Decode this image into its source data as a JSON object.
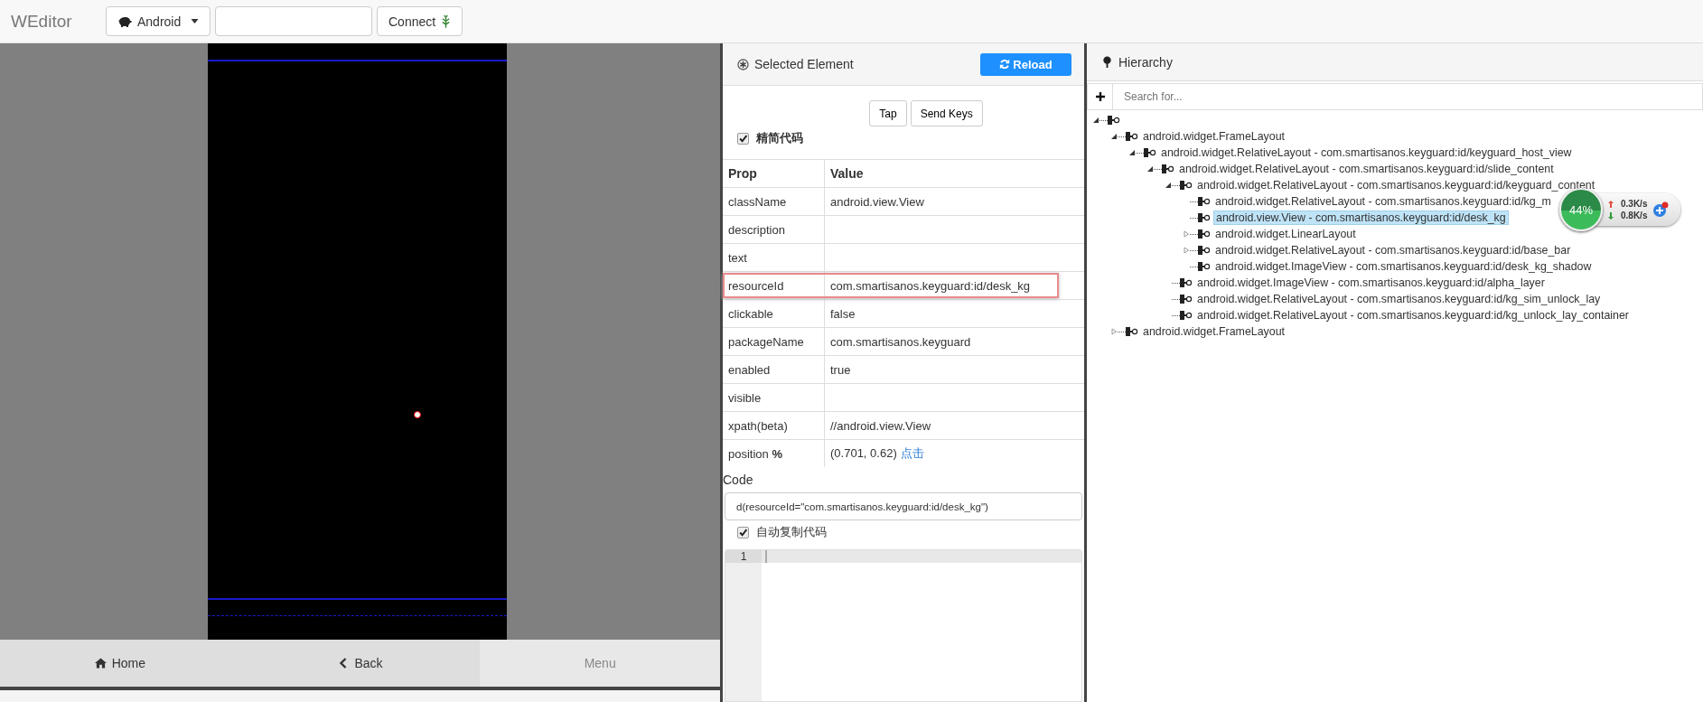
{
  "app_title": "WEditor",
  "toolbar": {
    "platform": "Android",
    "connect": "Connect"
  },
  "device_screen": {
    "tap_marker": true
  },
  "nav_buttons": [
    {
      "label": "Home",
      "kind": "home",
      "disabled": false
    },
    {
      "label": "Back",
      "kind": "back",
      "disabled": false
    },
    {
      "label": "Menu",
      "kind": "menu",
      "disabled": true
    }
  ],
  "selected_element": {
    "title": "Selected Element",
    "reload": "Reload",
    "actions": [
      "Tap",
      "Send Keys"
    ],
    "simplify_code": {
      "label": "精简代码",
      "checked": true
    },
    "columns": [
      "Prop",
      "Value"
    ],
    "rows": [
      {
        "prop": "className",
        "value": "android.view.View",
        "highlighted": false
      },
      {
        "prop": "description",
        "highlighted": false
      },
      {
        "prop": "text",
        "highlighted": false
      },
      {
        "prop": "resourceId",
        "value": "com.smartisanos.keyguard:id/desk_kg",
        "highlighted": true
      },
      {
        "prop": "clickable",
        "value": "false",
        "highlighted": false
      },
      {
        "prop": "packageName",
        "value": "com.smartisanos.keyguard",
        "highlighted": false
      },
      {
        "prop": "enabled",
        "value": "true",
        "highlighted": false
      },
      {
        "prop": "visible",
        "highlighted": false
      },
      {
        "prop": "xpath(beta)",
        "value": "//android.view.View",
        "highlighted": false
      },
      {
        "prop": "position **%**",
        "value": "(0.701, 0.62)",
        "link": "点击",
        "highlighted": false
      }
    ],
    "code_label": "Code",
    "code": "d(resourceId=\"com.smartisanos.keyguard:id/desk_kg\")",
    "auto_copy": {
      "label": "自动复制代码",
      "checked": true
    },
    "editor_lines": [
      "1"
    ]
  },
  "hierarchy": {
    "title": "Hierarchy",
    "search": {
      "placeholder": "Search for..."
    },
    "tree": [
      {
        "kind": "branch",
        "expanded": true,
        "selected": false,
        "children": [
          {
            "label": "android.widget.FrameLayout",
            "kind": "branch",
            "expanded": true,
            "selected": false,
            "children": [
              {
                "label": "android.widget.RelativeLayout - com.smartisanos.keyguard:id/keyguard_host_view",
                "kind": "branch",
                "expanded": true,
                "selected": false,
                "children": [
                  {
                    "label": "android.widget.RelativeLayout - com.smartisanos.keyguard:id/slide_content",
                    "kind": "branch",
                    "expanded": true,
                    "selected": false,
                    "children": [
                      {
                        "label": "android.widget.RelativeLayout - com.smartisanos.keyguard:id/keyguard_content",
                        "kind": "branch",
                        "expanded": true,
                        "selected": false,
                        "children": [
                          {
                            "label": "android.widget.RelativeLayout - com.smartisanos.keyguard:id/kg_m",
                            "kind": "leaf",
                            "selected": false
                          },
                          {
                            "label": "android.view.View - com.smartisanos.keyguard:id/desk_kg",
                            "kind": "leaf",
                            "selected": true
                          },
                          {
                            "label": "android.widget.LinearLayout",
                            "kind": "branch",
                            "expanded": false,
                            "selected": false
                          },
                          {
                            "label": "android.widget.RelativeLayout - com.smartisanos.keyguard:id/base_bar",
                            "kind": "branch",
                            "expanded": false,
                            "selected": false
                          },
                          {
                            "label": "android.widget.ImageView - com.smartisanos.keyguard:id/desk_kg_shadow",
                            "kind": "leaf",
                            "selected": false
                          }
                        ]
                      },
                      {
                        "label": "android.widget.ImageView - com.smartisanos.keyguard:id/alpha_layer",
                        "kind": "leaf",
                        "selected": false
                      },
                      {
                        "label": "android.widget.RelativeLayout - com.smartisanos.keyguard:id/kg_sim_unlock_lay",
                        "kind": "leaf",
                        "selected": false
                      },
                      {
                        "label": "android.widget.RelativeLayout - com.smartisanos.keyguard:id/kg_unlock_lay_container",
                        "kind": "leaf",
                        "selected": false
                      }
                    ]
                  }
                ]
              }
            ]
          },
          {
            "label": "android.widget.FrameLayout",
            "kind": "branch",
            "expanded": false,
            "selected": false
          }
        ]
      }
    ]
  },
  "speed_widget": {
    "percent": "44%",
    "upload": "0.3K/s",
    "download": "0.8K/s"
  }
}
